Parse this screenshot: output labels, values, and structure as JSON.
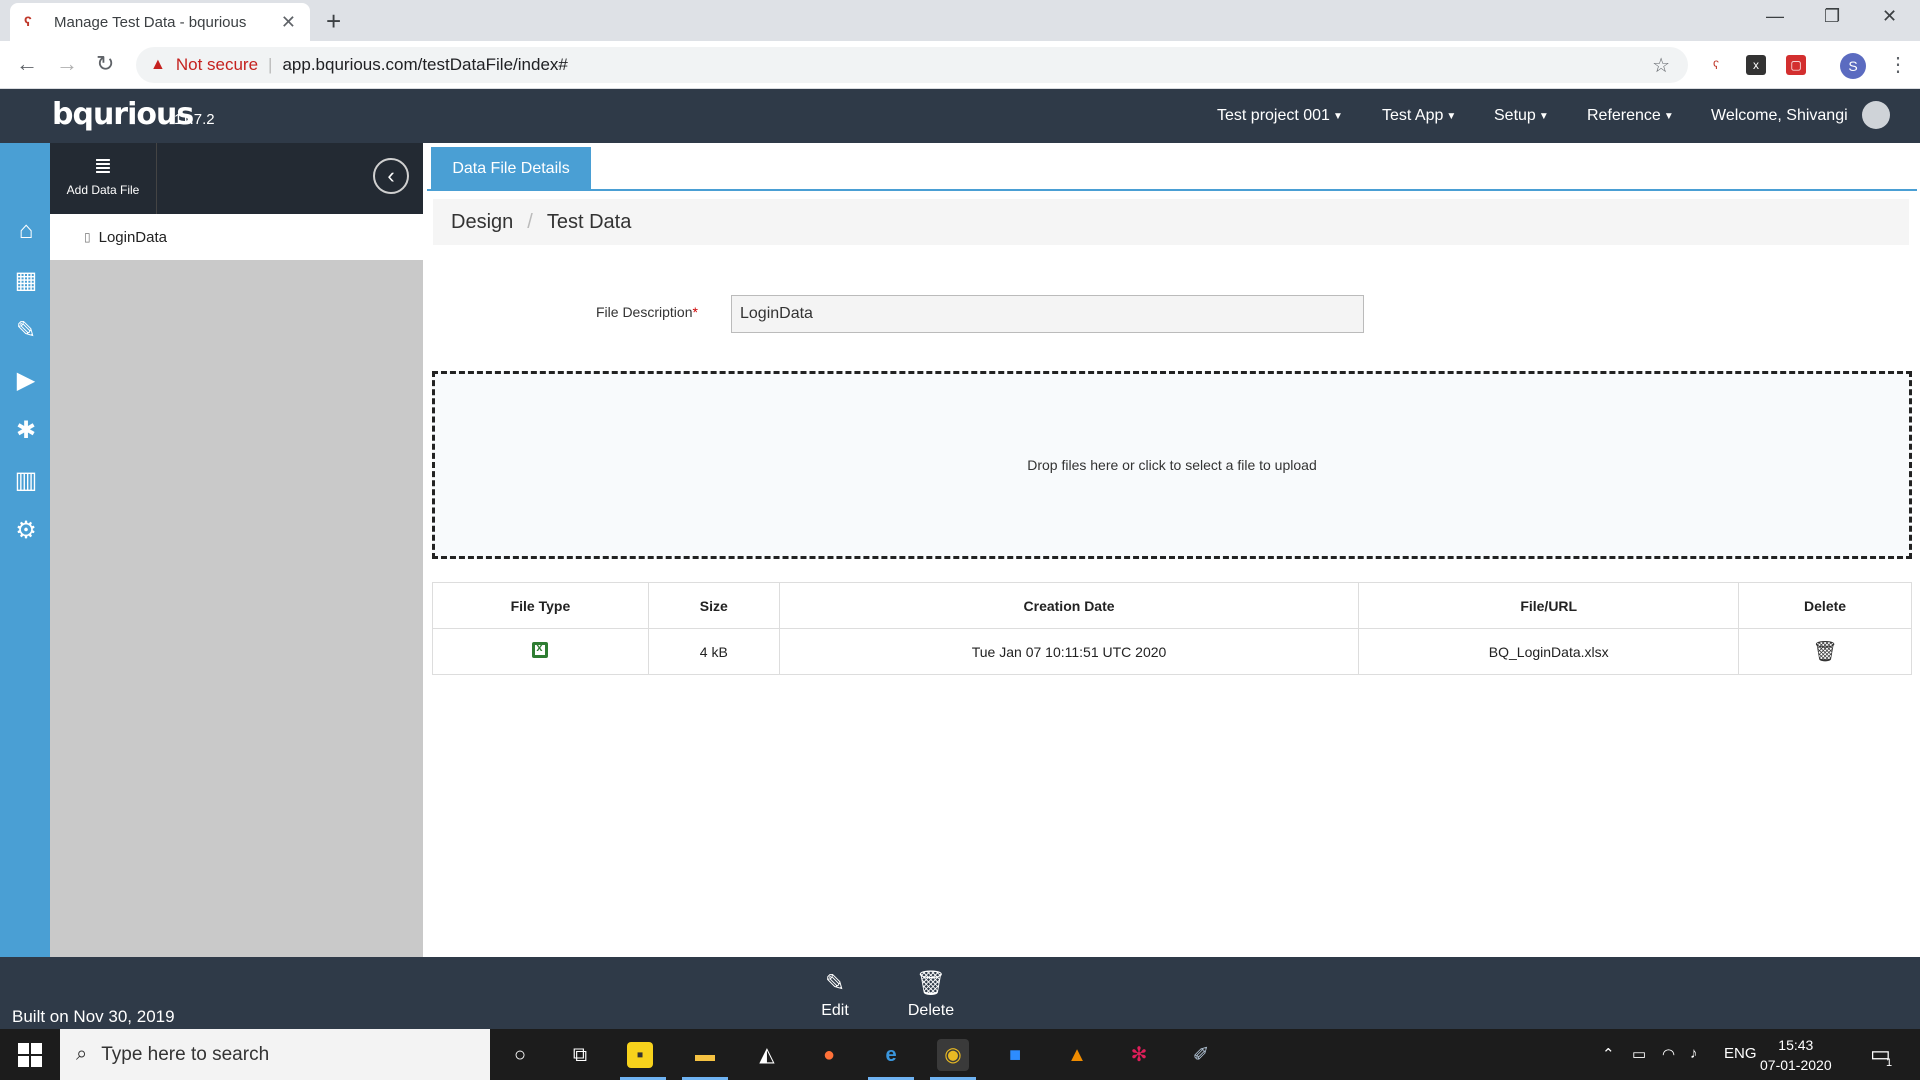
{
  "browser": {
    "tab_title": "Manage Test Data - bqurious",
    "tab_favicon": "bq-favicon",
    "security_label": "Not secure",
    "url": "app.bqurious.com/testDataFile/index#",
    "profile_initial": "S"
  },
  "app": {
    "logo": "bqurious",
    "version": "11.7.2",
    "nav": [
      "Test project 001",
      "Test App",
      "Setup",
      "Reference"
    ],
    "welcome": "Welcome, Shivangi"
  },
  "rail_icons": [
    "home-icon",
    "calendar-icon",
    "pencil-icon",
    "play-icon",
    "bug-icon",
    "bar-chart-icon",
    "gears-icon"
  ],
  "sidebar": {
    "add_label": "Add Data File",
    "items": [
      {
        "label": "LoginData"
      }
    ]
  },
  "main": {
    "tab_label": "Data File Details",
    "breadcrumb": [
      "Design",
      "Test Data"
    ],
    "file_description_label": "File Description",
    "file_description_value": "LoginData",
    "dropzone_text": "Drop files here or click to select a file to upload",
    "table": {
      "headers": [
        "File Type",
        "Size",
        "Creation Date",
        "File/URL",
        "Delete"
      ],
      "rows": [
        {
          "file_type_icon": "excel-file-icon",
          "size": "4 kB",
          "creation_date": "Tue Jan 07 10:11:51 UTC 2020",
          "file_url": "BQ_LoginData.xlsx",
          "delete_icon": "trash-icon"
        }
      ]
    }
  },
  "footer": {
    "built": "Built on Nov 30, 2019",
    "edit_label": "Edit",
    "delete_label": "Delete"
  },
  "taskbar": {
    "search_placeholder": "Type here to search",
    "lang": "ENG",
    "time": "15:43",
    "date": "07-01-2020",
    "notification_count": "1"
  },
  "colors": {
    "accent": "#4a9fd4",
    "header": "#2f3a48",
    "sidebar": "#c9c9c9",
    "danger": "#c5221f"
  }
}
